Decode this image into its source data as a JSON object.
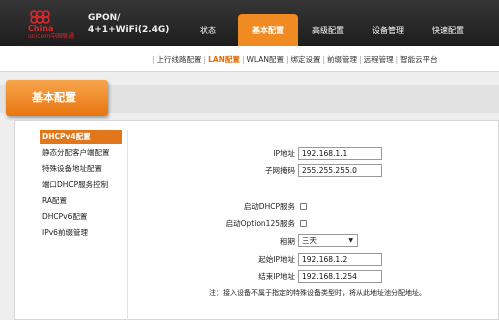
{
  "header": {
    "brand_cn": "中国联通",
    "brand_en_1": "China",
    "brand_en_2": "unicom中国联通",
    "device_line1": "GPON/",
    "device_line2": "4+1+WiFi(2.4G)",
    "tabs": [
      {
        "label": "状态"
      },
      {
        "label": "基本配置"
      },
      {
        "label": "高级配置"
      },
      {
        "label": "设备管理"
      },
      {
        "label": "快速配置"
      }
    ],
    "active_tab": "基本配置",
    "accent": "#f08a22"
  },
  "subnav": {
    "items": [
      {
        "label": "上行线路配置"
      },
      {
        "label": "LAN配置"
      },
      {
        "label": "WLAN配置"
      },
      {
        "label": "绑定设置"
      },
      {
        "label": "前缀管理"
      },
      {
        "label": "远程管理"
      },
      {
        "label": "智能云平台"
      }
    ],
    "separator": "|",
    "active": "LAN配置"
  },
  "banner": {
    "title": "基本配置"
  },
  "sidebar": {
    "items": [
      {
        "label": "DHCPv4配置"
      },
      {
        "label": "静态分配客户端配置"
      },
      {
        "label": "特殊设备地址配置"
      },
      {
        "label": "端口DHCP服务控制"
      },
      {
        "label": "RA配置"
      },
      {
        "label": "DHCPv6配置"
      },
      {
        "label": "IPv6前缀管理"
      }
    ],
    "active": "DHCPv4配置"
  },
  "form": {
    "ip_label": "IP地址",
    "ip_value": "192.168.1.1",
    "mask_label": "子网掩码",
    "mask_value": "255.255.255.0",
    "dhcp_label": "启动DHCP服务",
    "dhcp_checked": false,
    "option125_label": "启动Option125服务",
    "option125_checked": false,
    "lease_label": "租期",
    "lease_value": "三天",
    "start_label": "起始IP地址",
    "start_value": "192.168.1.2",
    "end_label": "结束IP地址",
    "end_value": "192.168.1.254",
    "note": "注：接入设备不属于指定的特殊设备类型时，将从此地址池分配地址。"
  }
}
